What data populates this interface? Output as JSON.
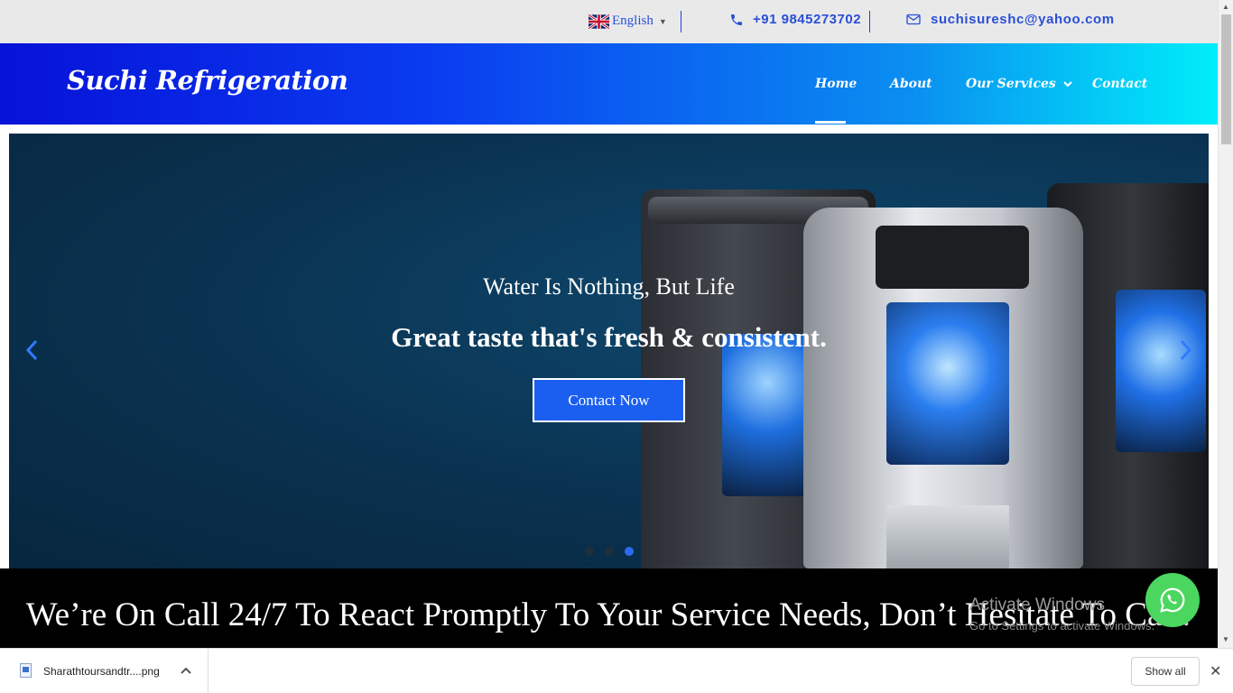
{
  "topbar": {
    "language": "English",
    "language_caret": "▼",
    "phone": "+91 9845273702",
    "email": "suchisureshc@yahoo.com"
  },
  "header": {
    "brand": "Suchi Refrigeration",
    "nav": [
      {
        "label": "Home",
        "active": true
      },
      {
        "label": "About"
      },
      {
        "label": "Our Services",
        "has_dropdown": true
      },
      {
        "label": "Contact"
      }
    ]
  },
  "slider": {
    "subtitle": "Water Is Nothing, But Life",
    "headline": "Great taste that's fresh & consistent.",
    "cta_label": "Contact Now",
    "prev_icon": "‹",
    "next_icon": "›",
    "slide_count": 3,
    "active_slide": 3
  },
  "banner": {
    "text": "We’re On Call 24/7 To React Promptly To Your Service Needs, Don’t Hesitate To Call!"
  },
  "watermark": {
    "title": "Activate Windows",
    "subtitle": "Go to Settings to activate Windows."
  },
  "downloads": {
    "file_name": "Sharathtoursandtr....png",
    "show_all": "Show all",
    "close": "✕"
  },
  "colors": {
    "accent": "#2a4fd6",
    "header_start": "#0712d8",
    "header_end": "#00eefa",
    "cta": "#1b5ff0",
    "whatsapp": "#4bd660"
  }
}
